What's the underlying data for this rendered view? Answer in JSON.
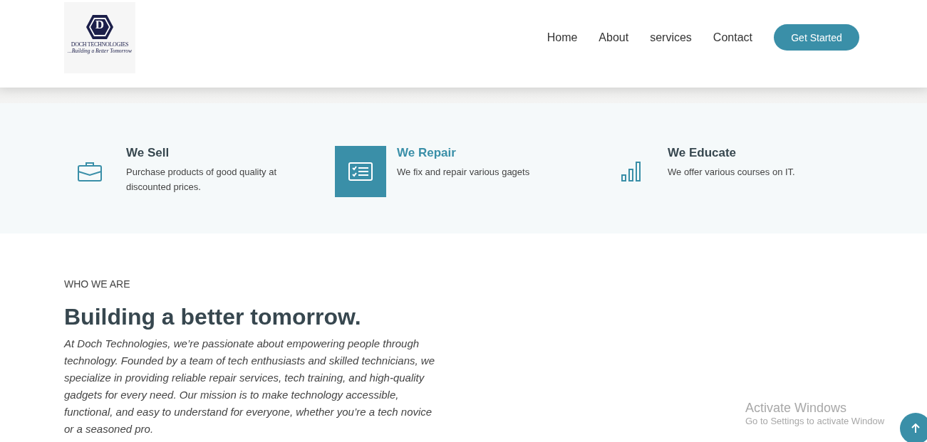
{
  "header": {
    "logo": {
      "letter": "D",
      "name": "DOCH TECHNOLOGIES",
      "tagline": "...Building a Better Tomorrow"
    },
    "nav": [
      {
        "label": "Home"
      },
      {
        "label": "About"
      },
      {
        "label": "services"
      },
      {
        "label": "Contact"
      }
    ],
    "cta": "Get Started"
  },
  "features": [
    {
      "kind": "briefcase",
      "title": "We Sell",
      "text": "Purchase products of good quality at discounted prices.",
      "active": false
    },
    {
      "kind": "checklist",
      "title": "We Repair",
      "text": "We fix and repair various gagets",
      "active": true
    },
    {
      "kind": "bars",
      "title": "We Educate",
      "text": "We offer various courses on IT.",
      "active": false
    }
  ],
  "about": {
    "eyebrow": "WHO WE ARE",
    "heading": "Building a better tomorrow.",
    "body": "At Doch Technologies, we’re passionate about empowering people through technology. Founded by a team of tech enthusiasts and skilled technicians, we specialize in providing reliable repair services, tech training, and high-quality gadgets for every need. Our mission is to make technology accessible, functional, and easy to understand for everyone, whether you’re a tech novice or a seasoned pro."
  },
  "os_notice": {
    "title": "Activate Windows",
    "text": "Go to Settings to activate Window"
  }
}
